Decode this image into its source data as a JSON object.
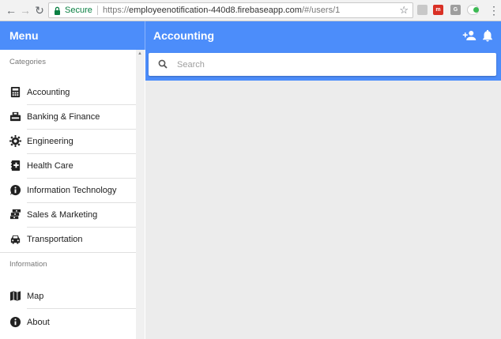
{
  "browser": {
    "secure_label": "Secure",
    "url_scheme": "https://",
    "url_host": "employeenotification-440d8.firebaseapp.com",
    "url_path": "/#/users/1",
    "extensions": [
      "gmail-ext",
      "grey-ext",
      "g-ext",
      "toggle-ext"
    ]
  },
  "header": {
    "menu_title": "Menu",
    "page_title": "Accounting",
    "accent": "#4c8dfa"
  },
  "search": {
    "placeholder": "Search",
    "value": ""
  },
  "sidebar": {
    "categories_label": "Categories",
    "categories": [
      {
        "label": "Accounting",
        "icon": "calculator-icon"
      },
      {
        "label": "Banking & Finance",
        "icon": "bank-icon"
      },
      {
        "label": "Engineering",
        "icon": "gear-icon"
      },
      {
        "label": "Health Care",
        "icon": "medical-book-icon"
      },
      {
        "label": "Information Technology",
        "icon": "info-bubble-icon"
      },
      {
        "label": "Sales & Marketing",
        "icon": "money-stack-icon"
      },
      {
        "label": "Transportation",
        "icon": "car-icon"
      }
    ],
    "information_label": "Information",
    "information": [
      {
        "label": "Map",
        "icon": "map-icon"
      },
      {
        "label": "About",
        "icon": "info-icon"
      }
    ]
  }
}
